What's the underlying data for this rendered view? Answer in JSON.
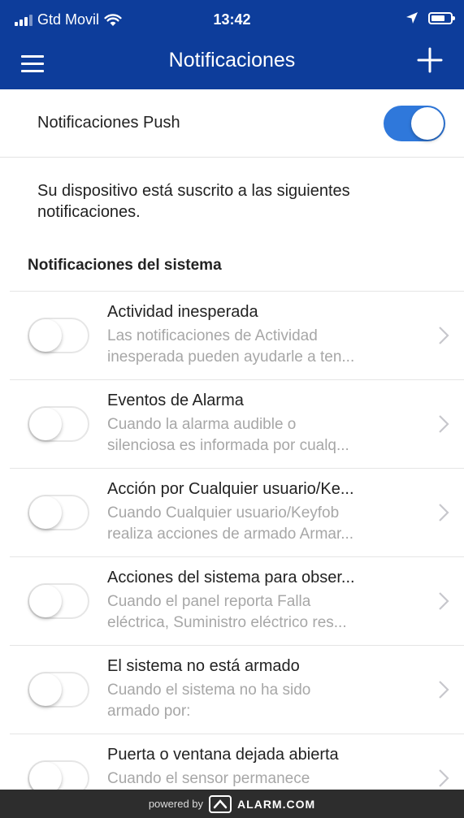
{
  "status_bar": {
    "carrier": "Gtd Movil",
    "time": "13:42"
  },
  "header": {
    "title": "Notificaciones"
  },
  "push": {
    "label": "Notificaciones Push",
    "enabled": true
  },
  "subscribed_text": "Su dispositivo está suscrito a las siguientes notificaciones.",
  "section": {
    "title": "Notificaciones del sistema"
  },
  "items": [
    {
      "title": "Actividad inesperada",
      "desc_line1": "Las notificaciones de Actividad",
      "desc_line2": "inesperada pueden ayudarle a ten...",
      "enabled": false
    },
    {
      "title": "Eventos de Alarma",
      "desc_line1": "Cuando la alarma audible o",
      "desc_line2": "silenciosa es informada por cualq...",
      "enabled": false
    },
    {
      "title": "Acción por Cualquier usuario/Ke...",
      "desc_line1": "Cuando Cualquier usuario/Keyfob",
      "desc_line2": "realiza acciones de armado Armar...",
      "enabled": false
    },
    {
      "title": "Acciones del sistema para obser...",
      "desc_line1": "Cuando el panel reporta Falla",
      "desc_line2": "eléctrica, Suministro eléctrico res...",
      "enabled": false
    },
    {
      "title": "El sistema no está armado",
      "desc_line1": "Cuando el sistema no ha sido",
      "desc_line2": "armado por:",
      "enabled": false
    },
    {
      "title": "Puerta o ventana dejada abierta",
      "desc_line1": "Cuando el sensor permanece",
      "desc_line2": "",
      "enabled": false
    }
  ],
  "footer": {
    "powered_by": "powered by",
    "brand": "ALARM.COM"
  },
  "colors": {
    "header_bg": "#0d3d9b",
    "toggle_on": "#2f78db",
    "footer_bg": "#2d2d2d"
  }
}
